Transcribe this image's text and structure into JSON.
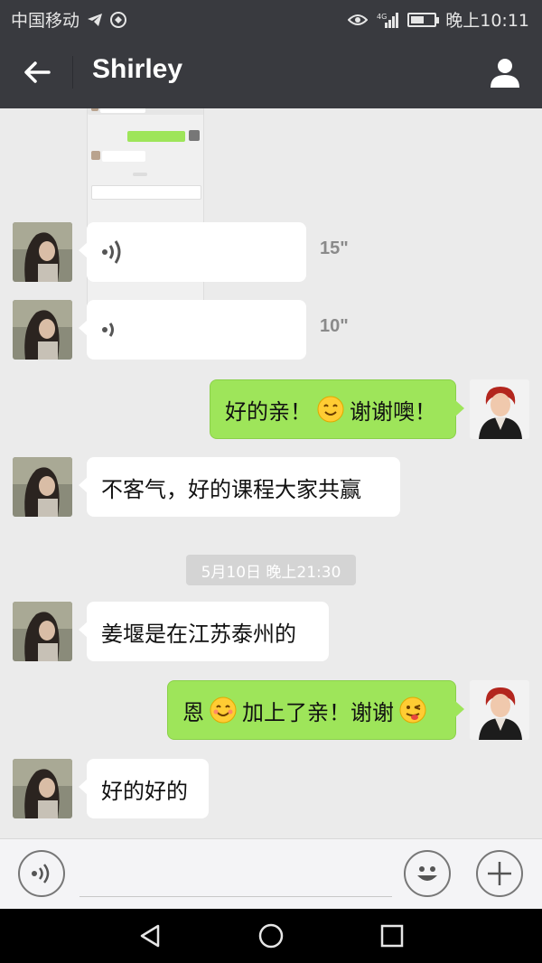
{
  "status_bar": {
    "carrier": "中国移动",
    "network": "4G",
    "time": "晚上10:11",
    "battery_level": 0.6
  },
  "header": {
    "contact_name": "Shirley",
    "back_icon": "back-arrow-icon",
    "profile_icon": "person-icon"
  },
  "messages": {
    "voice1": {
      "duration": "15\""
    },
    "voice2": {
      "duration": "10\""
    },
    "out1": {
      "text_a": "好的亲！",
      "text_b": "谢谢噢！"
    },
    "in1": {
      "text": "不客气，好的课程大家共赢"
    },
    "timestamp": "5月10日 晚上21:30",
    "in2": {
      "text": "姜堰是在江苏泰州的"
    },
    "out2": {
      "text_a": "恩",
      "text_b": "加上了亲！谢谢"
    },
    "in3": {
      "text": "好的好的"
    }
  },
  "input_bar": {
    "voice_icon": "voice-icon",
    "emoji_icon": "smiley-icon",
    "plus_icon": "plus-icon",
    "placeholder": ""
  },
  "colors": {
    "header_bg": "#393a3f",
    "chat_bg": "#ebebeb",
    "outgoing_bubble": "#9ee55a",
    "incoming_bubble": "#ffffff"
  }
}
